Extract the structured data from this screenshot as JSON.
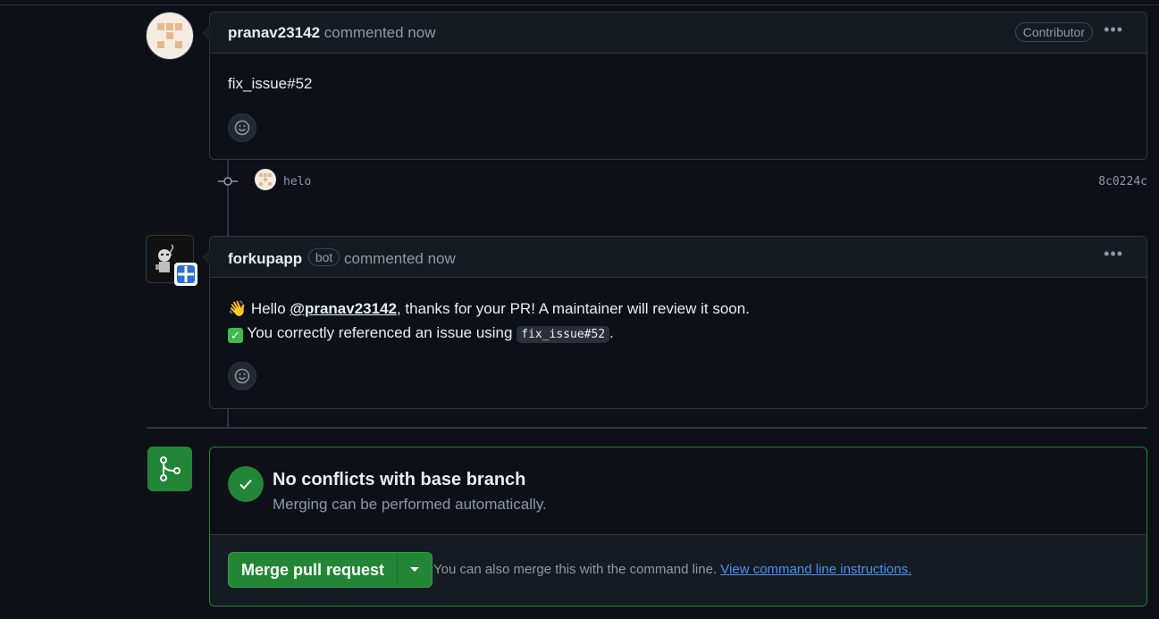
{
  "comment1": {
    "author": "pranav23142",
    "action": "commented now",
    "role_badge": "Contributor",
    "body": "fix_issue#52"
  },
  "commit": {
    "message": "helo",
    "sha": "8c0224c"
  },
  "comment2": {
    "author": "forkupapp",
    "bot_badge": "bot",
    "action": "commented now",
    "line1_prefix": "Hello ",
    "line1_mention": "@pranav23142",
    "line1_suffix": ", thanks for your PR! A maintainer will review it soon.",
    "line2_text": "You correctly referenced an issue using ",
    "line2_code": "fix_issue#52",
    "line2_end": "."
  },
  "merge": {
    "title": "No conflicts with base branch",
    "subtitle": "Merging can be performed automatically.",
    "button_label": "Merge pull request",
    "hint_text": "You can also merge this with the command line.",
    "hint_link": "View command line instructions.",
    "accent_color": "#238636"
  },
  "icons": [
    "comment-menu-icon",
    "emoji-smiley-icon",
    "commit-node-icon",
    "git-merge-icon",
    "check-icon",
    "caret-down-icon",
    "wave-emoji-icon",
    "checkmark-emoji-icon"
  ]
}
